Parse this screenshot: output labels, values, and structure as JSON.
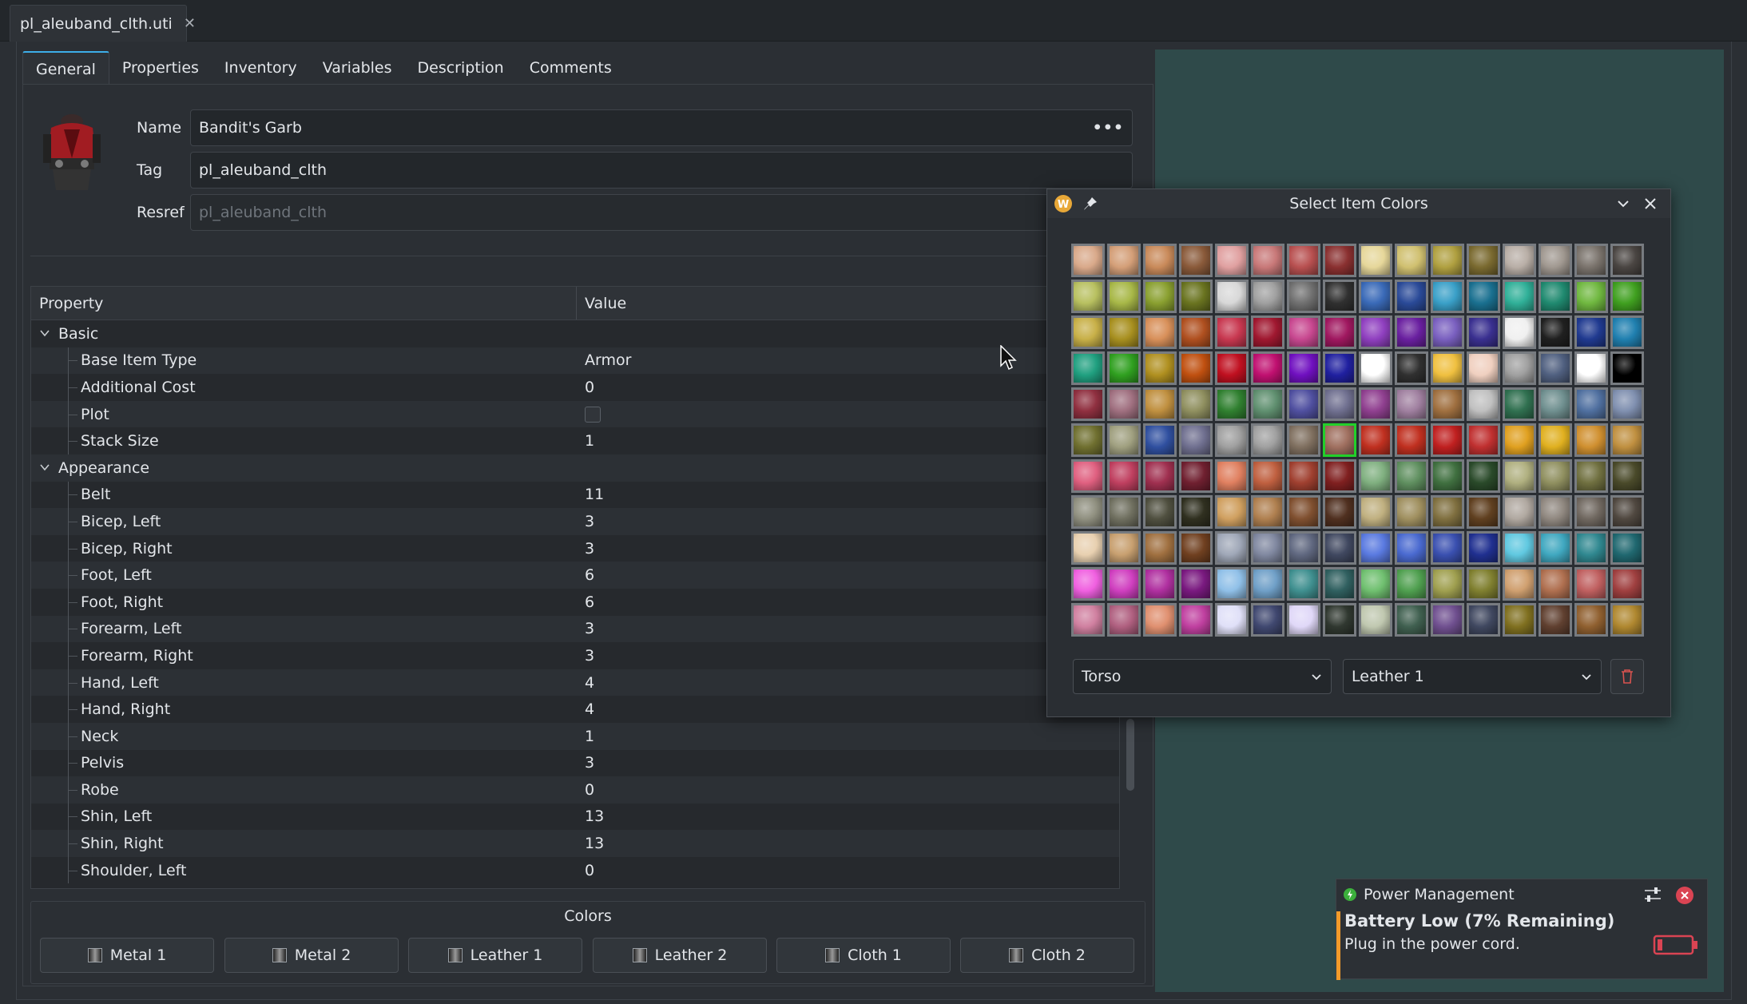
{
  "file_tab": {
    "name": "pl_aleuband_clth.uti"
  },
  "editor_tabs": [
    "General",
    "Properties",
    "Inventory",
    "Variables",
    "Description",
    "Comments"
  ],
  "fields": {
    "name_label": "Name",
    "name_value": "Bandit's Garb",
    "name_more": "•••",
    "tag_label": "Tag",
    "tag_value": "pl_aleuband_clth",
    "resref_label": "Resref",
    "resref_placeholder": "pl_aleuband_clth"
  },
  "tree": {
    "col_property": "Property",
    "col_value": "Value",
    "rows": [
      {
        "label": "Basic",
        "value": "",
        "group": true
      },
      {
        "label": "Base Item Type",
        "value": "Armor"
      },
      {
        "label": "Additional Cost",
        "value": "0"
      },
      {
        "label": "Plot",
        "value": "",
        "checkbox": true
      },
      {
        "label": "Stack Size",
        "value": "1"
      },
      {
        "label": "Appearance",
        "value": "",
        "group": true
      },
      {
        "label": "Belt",
        "value": "11"
      },
      {
        "label": "Bicep, Left",
        "value": "3"
      },
      {
        "label": "Bicep, Right",
        "value": "3"
      },
      {
        "label": "Foot, Left",
        "value": "6"
      },
      {
        "label": "Foot, Right",
        "value": "6"
      },
      {
        "label": "Forearm, Left",
        "value": "3"
      },
      {
        "label": "Forearm, Right",
        "value": "3"
      },
      {
        "label": "Hand, Left",
        "value": "4"
      },
      {
        "label": "Hand, Right",
        "value": "4"
      },
      {
        "label": "Neck",
        "value": "1"
      },
      {
        "label": "Pelvis",
        "value": "3"
      },
      {
        "label": "Robe",
        "value": "0"
      },
      {
        "label": "Shin, Left",
        "value": "13"
      },
      {
        "label": "Shin, Right",
        "value": "13"
      },
      {
        "label": "Shoulder, Left",
        "value": "0"
      }
    ]
  },
  "colors": {
    "title": "Colors",
    "buttons": [
      "Metal 1",
      "Metal 2",
      "Leather 1",
      "Leather 2",
      "Cloth 1",
      "Cloth 2"
    ]
  },
  "dialog": {
    "title": "Select Item Colors",
    "part_select": "Torso",
    "channel_select": "Leather 1",
    "selected_index": 87,
    "palette": [
      "#d9a98a",
      "#d49f78",
      "#c98a5a",
      "#8a5a3a",
      "#e0a0a0",
      "#c87878",
      "#b85050",
      "#8a3030",
      "#e6d79a",
      "#d0c070",
      "#b0a040",
      "#7a6a30",
      "#b8aea6",
      "#a09890",
      "#7a736c",
      "#4a4542",
      "#b8c060",
      "#a8b848",
      "#8aa030",
      "#6a7420",
      "#d8d8d8",
      "#a0a0a0",
      "#707070",
      "#303030",
      "#3a6ab8",
      "#2a4a98",
      "#3aa0c8",
      "#1a7090",
      "#30b098",
      "#208a70",
      "#70b840",
      "#40a020",
      "#c8b048",
      "#a89020",
      "#d8905a",
      "#b05020",
      "#c83850",
      "#a01830",
      "#c84890",
      "#a01860",
      "#9040c0",
      "#6a20a0",
      "#7a60c0",
      "#3a3090",
      "#f0f0f0",
      "#202020",
      "#203a90",
      "#2080b0",
      "#20a080",
      "#30a020",
      "#b09020",
      "#c05010",
      "#c01020",
      "#c01070",
      "#7010c0",
      "#2020a0",
      "#ffffff",
      "#303030",
      "#f0c040",
      "#f0d0c0",
      "#a0a0a0",
      "#506080",
      "#ffffff",
      "#000000",
      "#903040",
      "#a07080",
      "#c09040",
      "#909060",
      "#308030",
      "#609070",
      "#5050a0",
      "#707090",
      "#904090",
      "#a080a0",
      "#a07040",
      "#c0c0c0",
      "#307050",
      "#709090",
      "#5070a0",
      "#8090b0",
      "#707030",
      "#a0a080",
      "#3050a0",
      "#707090",
      "#a0a0a0",
      "#a0a0a0",
      "#807060",
      "#a07060",
      "#c03020",
      "#c03020",
      "#c02020",
      "#c03030",
      "#e0a020",
      "#e0b020",
      "#d09030",
      "#c09040",
      "#e06080",
      "#c04060",
      "#a03050",
      "#702030",
      "#e08060",
      "#c06040",
      "#a04030",
      "#802020",
      "#80b080",
      "#609060",
      "#407040",
      "#2a4a2a",
      "#b0b080",
      "#909060",
      "#707040",
      "#4a4a2a",
      "#909080",
      "#707060",
      "#505040",
      "#303020",
      "#d0a060",
      "#b08050",
      "#805030",
      "#503020",
      "#c0b080",
      "#a09060",
      "#807040",
      "#604020",
      "#b0a8a0",
      "#908880",
      "#706860",
      "#504840",
      "#e8d0b0",
      "#c8a070",
      "#a07040",
      "#704020",
      "#a0a8b8",
      "#8088a0",
      "#606880",
      "#404860",
      "#5a7ae0",
      "#4a6ad0",
      "#3a50b0",
      "#203090",
      "#60c8e0",
      "#40a8c0",
      "#308890",
      "#206870",
      "#f060e0",
      "#d040c0",
      "#b030a0",
      "#7a1a80",
      "#90c0e8",
      "#70a0c8",
      "#409090",
      "#306060",
      "#70c070",
      "#50a050",
      "#a0a050",
      "#808030",
      "#d0a070",
      "#b07050",
      "#c06060",
      "#a04040",
      "#d080a0",
      "#b06080",
      "#e09070",
      "#c040a0",
      "#e0e0f8",
      "#404870",
      "#e0d8f8",
      "#303830",
      "#c0c8b0",
      "#406050",
      "#705090",
      "#404860",
      "#807020",
      "#604030",
      "#906030",
      "#b08830"
    ]
  },
  "notification": {
    "app": "Power Management",
    "title": "Battery Low (7% Remaining)",
    "body": "Plug in the power cord."
  }
}
